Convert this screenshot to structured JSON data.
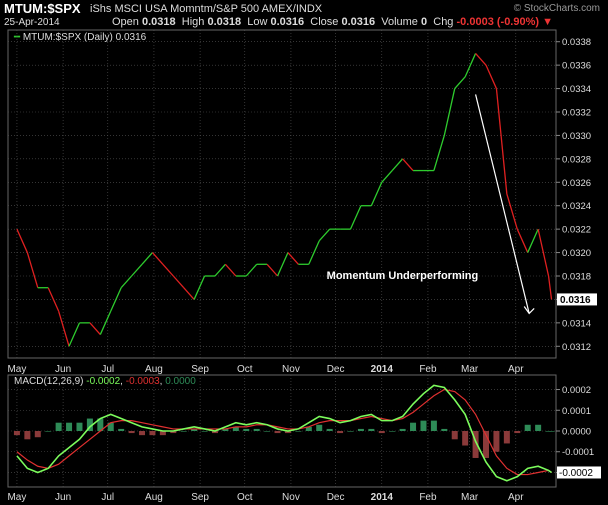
{
  "header": {
    "symbol": "MTUM:$SPX",
    "description": "iShs MSCI USA Momntm/S&P 500  AMEX/INDX",
    "brand": "© StockCharts.com",
    "date": "25-Apr-2014",
    "open_label": "Open",
    "open": "0.0318",
    "high_label": "High",
    "high": "0.0318",
    "low_label": "Low",
    "low": "0.0316",
    "close_label": "Close",
    "close": "0.0316",
    "volume_label": "Volume",
    "volume": "0",
    "chg_label": "Chg",
    "chg": "-0.0003 (-0.90%)"
  },
  "colors": {
    "up": "#2ecc2e",
    "down": "#e02020",
    "macd_line": "#7cfc5c",
    "signal_line": "#e03030",
    "hist_pos": "#2e8b57",
    "hist_neg": "#8b3a3a",
    "bg": "#000000",
    "grid": "#555555"
  },
  "chart_data": [
    {
      "type": "line",
      "title": "MTUM:$SPX",
      "legend": {
        "name": "MTUM:$SPX (Daily)",
        "value": "0.0316",
        "placement": "top-left"
      },
      "last_value_label": "0.0316",
      "annotation": "Momentum Underperforming",
      "ylim": [
        0.0311,
        0.0339
      ],
      "y_ticks": [
        "0.0312",
        "0.0314",
        "0.0316",
        "0.0318",
        "0.0320",
        "0.0322",
        "0.0324",
        "0.0326",
        "0.0328",
        "0.0330",
        "0.0332",
        "0.0334",
        "0.0336",
        "0.0338"
      ],
      "x_labels": [
        "May",
        "Jun",
        "Jul",
        "Aug",
        "Sep",
        "Oct",
        "Nov",
        "Dec",
        "2014",
        "Feb",
        "Mar",
        "Apr"
      ],
      "grid": true,
      "x_dates": [
        "2013-05-01",
        "2013-05-08",
        "2013-05-15",
        "2013-05-22",
        "2013-05-29",
        "2013-06-05",
        "2013-06-12",
        "2013-06-19",
        "2013-06-26",
        "2013-07-03",
        "2013-07-10",
        "2013-07-17",
        "2013-07-24",
        "2013-07-31",
        "2013-08-07",
        "2013-08-14",
        "2013-08-21",
        "2013-08-28",
        "2013-09-04",
        "2013-09-11",
        "2013-09-18",
        "2013-09-25",
        "2013-10-02",
        "2013-10-09",
        "2013-10-16",
        "2013-10-23",
        "2013-10-30",
        "2013-11-06",
        "2013-11-13",
        "2013-11-20",
        "2013-11-27",
        "2013-12-04",
        "2013-12-11",
        "2013-12-18",
        "2013-12-25",
        "2014-01-01",
        "2014-01-08",
        "2014-01-15",
        "2014-01-22",
        "2014-01-29",
        "2014-02-05",
        "2014-02-12",
        "2014-02-19",
        "2014-02-26",
        "2014-03-05",
        "2014-03-12",
        "2014-03-19",
        "2014-03-26",
        "2014-04-02",
        "2014-04-09",
        "2014-04-16",
        "2014-04-23",
        "2014-04-25"
      ],
      "values": [
        0.0322,
        0.032,
        0.0317,
        0.0317,
        0.0315,
        0.0312,
        0.0314,
        0.0314,
        0.0313,
        0.0315,
        0.0317,
        0.0318,
        0.0319,
        0.032,
        0.0319,
        0.0318,
        0.0317,
        0.0316,
        0.0318,
        0.0318,
        0.0319,
        0.0318,
        0.0318,
        0.0319,
        0.0319,
        0.0318,
        0.032,
        0.0319,
        0.0319,
        0.0321,
        0.0322,
        0.0322,
        0.0322,
        0.0324,
        0.0324,
        0.0326,
        0.0327,
        0.0328,
        0.0327,
        0.0327,
        0.0327,
        0.033,
        0.0334,
        0.0335,
        0.0337,
        0.0336,
        0.0334,
        0.0325,
        0.0322,
        0.032,
        0.0322,
        0.0318,
        0.0316
      ]
    },
    {
      "type": "line",
      "title": "MACD(12,26,9)",
      "legend_values": [
        "-0.0002",
        "-0.0003",
        "0.0000"
      ],
      "ylim": [
        -0.00027,
        0.00027
      ],
      "y_ticks": [
        "0.0002",
        "0.0001",
        "0.0000",
        "-0.0001",
        "-0.0002"
      ],
      "last_value_label": "-0.0002",
      "x_labels": [
        "May",
        "Jun",
        "Jul",
        "Aug",
        "Sep",
        "Oct",
        "Nov",
        "Dec",
        "2014",
        "Feb",
        "Mar",
        "Apr"
      ],
      "series": [
        {
          "values": [
            -0.00012,
            -0.00018,
            -0.0002,
            -0.00018,
            -0.00012,
            -8e-05,
            -4e-05,
            2e-05,
            6e-05,
            8e-05,
            6e-05,
            4e-05,
            2e-05,
            1e-05,
            0.0,
            0.0,
            1e-05,
            2e-05,
            1e-05,
            0.0,
            2e-05,
            4e-05,
            3e-05,
            4e-05,
            3e-05,
            1e-05,
            0.0,
            1e-05,
            4e-05,
            7e-05,
            6e-05,
            4e-05,
            5e-05,
            7e-05,
            8e-05,
            5e-05,
            5e-05,
            7e-05,
            0.00013,
            0.00018,
            0.00022,
            0.00021,
            0.00015,
            8e-05,
            -5e-05,
            -0.00015,
            -0.00022,
            -0.00024,
            -0.00022,
            -0.00018,
            -0.00017,
            -0.00019,
            -0.0002
          ]
        },
        {
          "values": [
            -0.0001,
            -0.00014,
            -0.00017,
            -0.00018,
            -0.00016,
            -0.00012,
            -8e-05,
            -4e-05,
            0.0,
            4e-05,
            5e-05,
            5e-05,
            4e-05,
            3e-05,
            2e-05,
            1e-05,
            1e-05,
            1e-05,
            1e-05,
            1e-05,
            1e-05,
            2e-05,
            2e-05,
            3e-05,
            3e-05,
            2e-05,
            1e-05,
            1e-05,
            2e-05,
            4e-05,
            5e-05,
            5e-05,
            5e-05,
            6e-05,
            7e-05,
            6e-05,
            5e-05,
            6e-05,
            9e-05,
            0.00013,
            0.00017,
            0.0002,
            0.00019,
            0.00015,
            8e-05,
            -2e-05,
            -0.00012,
            -0.00018,
            -0.00021,
            -0.00021,
            -0.0002,
            -0.00019,
            -0.0002
          ]
        }
      ],
      "histogram": [
        -2e-05,
        -4e-05,
        -3e-05,
        0.0,
        4e-05,
        4e-05,
        4e-05,
        6e-05,
        6e-05,
        4e-05,
        1e-05,
        -1e-05,
        -2e-05,
        -2e-05,
        -2e-05,
        -1e-05,
        0.0,
        1e-05,
        0.0,
        -1e-05,
        1e-05,
        2e-05,
        1e-05,
        1e-05,
        0.0,
        -1e-05,
        -1e-05,
        0.0,
        2e-05,
        3e-05,
        1e-05,
        -1e-05,
        0.0,
        1e-05,
        1e-05,
        -1e-05,
        0.0,
        1e-05,
        4e-05,
        5e-05,
        5e-05,
        1e-05,
        -4e-05,
        -7e-05,
        -0.00013,
        -0.00013,
        -0.0001,
        -6e-05,
        -1e-05,
        3e-05,
        3e-05,
        0.0,
        0.0
      ]
    }
  ]
}
